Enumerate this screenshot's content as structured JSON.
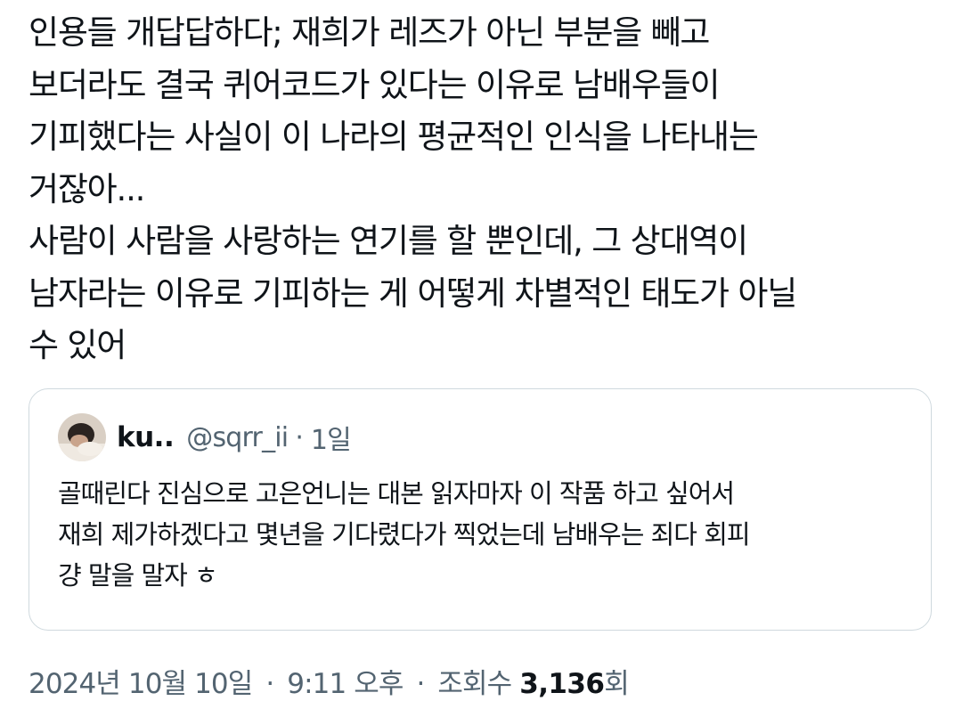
{
  "tweet": {
    "lines": [
      "인용들 개답답하다; 재희가 레즈가 아닌 부분을 빼고",
      "보더라도 결국 퀴어코드가 있다는 이유로 남배우들이",
      "기피했다는 사실이 이 나라의 평균적인 인식을 나타내는",
      "거잖아...",
      "사람이 사람을 사랑하는 연기를 할 뿐인데, 그 상대역이",
      "남자라는 이유로 기피하는 게 어떻게 차별적인 태도가 아닐",
      "수 있어"
    ]
  },
  "quote": {
    "author_name": "ku..",
    "handle": "@sqrr_ii",
    "separator": "·",
    "time": "1일",
    "lines": [
      "골때린다 진심으로 고은언니는 대본 읽자마자 이 작품 하고 싶어서",
      "재희 제가하겠다고 몇년을 기다렸다가 찍었는데 남배우는 죄다 회피",
      "걍 말을 말자 ㅎ"
    ]
  },
  "meta": {
    "date": "2024년 10월 10일",
    "separator": "·",
    "time": "9:11 오후",
    "views_label": "조회수",
    "views_count": "3,136",
    "views_unit": "회"
  },
  "colors": {
    "text": "#0f1419",
    "secondary": "#536471",
    "border": "#cfd9de"
  }
}
